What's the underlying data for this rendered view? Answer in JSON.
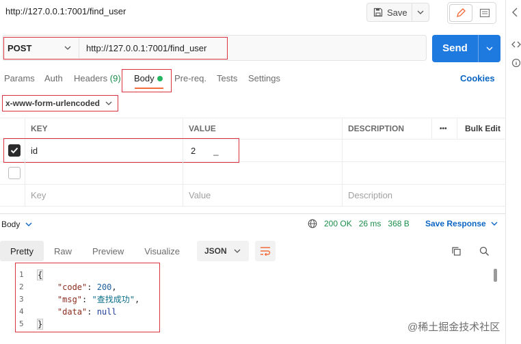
{
  "header": {
    "title": "http://127.0.0.1:7001/find_user",
    "save_label": "Save"
  },
  "request": {
    "method": "POST",
    "url": "http://127.0.0.1:7001/find_user",
    "send_label": "Send"
  },
  "tabs": [
    {
      "label": "Params"
    },
    {
      "label": "Auth"
    },
    {
      "label": "Headers"
    },
    {
      "label": "Body"
    },
    {
      "label": "Pre-req."
    },
    {
      "label": "Tests"
    },
    {
      "label": "Settings"
    }
  ],
  "headers_count": "(9)",
  "cookies_label": "Cookies",
  "body_encoding": "x-www-form-urlencoded",
  "table": {
    "headers": {
      "key": "KEY",
      "value": "VALUE",
      "description": "DESCRIPTION",
      "more": "•••",
      "bulk_edit": "Bulk Edit"
    },
    "rows": [
      {
        "checked": true,
        "key": "id",
        "value": "2",
        "cursor": "_"
      }
    ],
    "placeholders": {
      "key": "Key",
      "value": "Value",
      "description": "Description"
    }
  },
  "response": {
    "body_label": "Body",
    "status": "200 OK",
    "time": "26 ms",
    "size": "368 B",
    "save_label": "Save Response",
    "tabs": [
      {
        "label": "Pretty"
      },
      {
        "label": "Raw"
      },
      {
        "label": "Preview"
      },
      {
        "label": "Visualize"
      }
    ],
    "format": "JSON",
    "code": {
      "line_numbers": [
        "1",
        "2",
        "3",
        "4",
        "5"
      ],
      "open_brace": "{",
      "close_brace": "}",
      "code_key": "\"code\"",
      "code_value": "200",
      "msg_key": "\"msg\"",
      "msg_value": "\"查找成功\"",
      "data_key": "\"data\"",
      "data_value": "null"
    }
  },
  "watermark": "@稀土掘金技术社区",
  "colors": {
    "accent": "#1f7ae0",
    "highlight": "#d9313f",
    "tab_underline": "#f26b3a",
    "status_dot": "#26b561",
    "link": "#0a65c2"
  },
  "icons": [
    "floppy-disk-icon",
    "chevron-down-icon",
    "pencil-icon",
    "document-icon",
    "globe-icon",
    "copy-icon",
    "search-icon",
    "wrap-lines-icon",
    "checkmark-icon"
  ]
}
